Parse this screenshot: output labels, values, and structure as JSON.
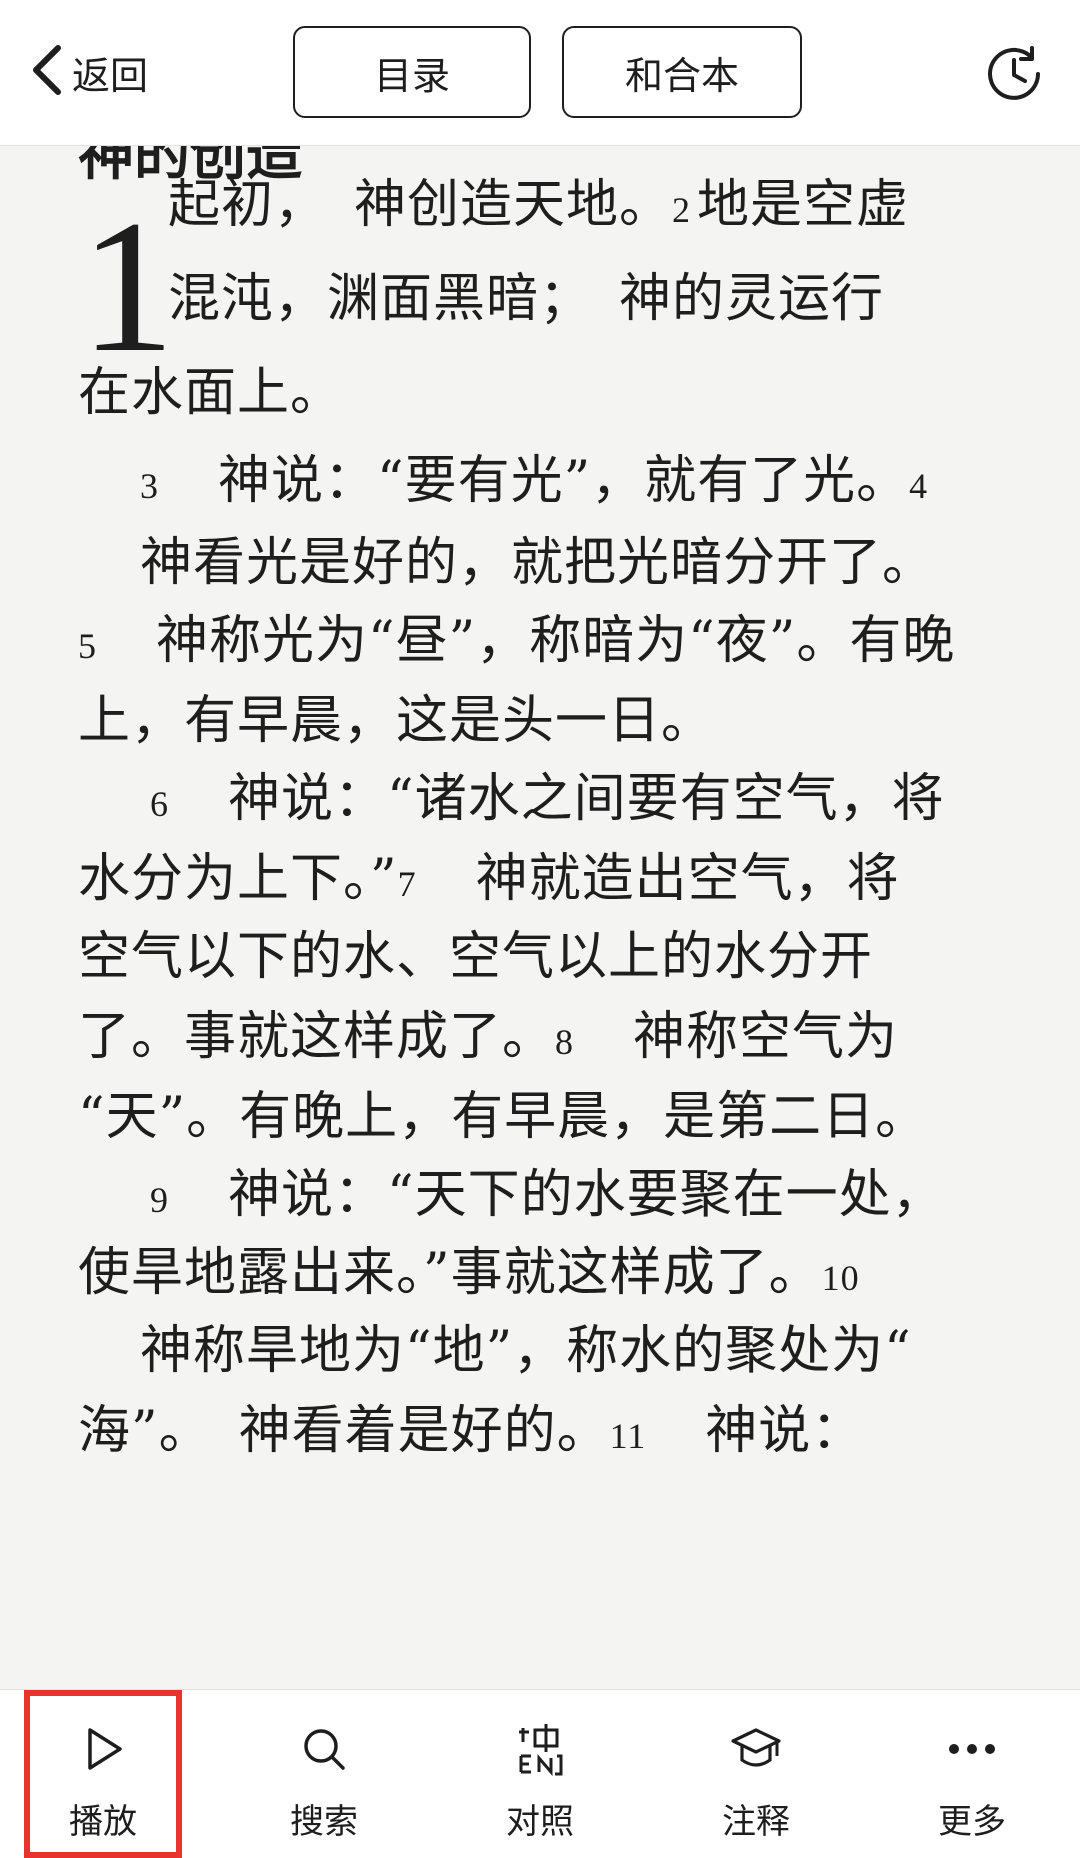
{
  "header": {
    "back_label": "返回",
    "catalog_label": "目录",
    "version_label": "和合本"
  },
  "reader": {
    "chapter_title": "神的创造",
    "chapter_number": "1",
    "lines": [
      {
        "parts": [
          {
            "t": "起初，　神创造天地。"
          },
          {
            "v": "2"
          },
          {
            "t": "地是空虚"
          }
        ]
      },
      {
        "parts": [
          {
            "t": "混沌，渊面黑暗；　神的灵运行"
          }
        ]
      },
      {
        "parts": [
          {
            "t": "在水面上。"
          }
        ]
      },
      {
        "parts": [
          {
            "v": "3"
          },
          {
            "t": "　神说：“要有光”，就有了光。"
          },
          {
            "v": "4"
          }
        ]
      },
      {
        "parts": [
          {
            "t": "神看光是好的，就把光暗分开了。"
          }
        ]
      },
      {
        "parts": [
          {
            "v": "5"
          },
          {
            "t": "　神称光为“昼”，称暗为“夜”。有晚"
          }
        ]
      },
      {
        "parts": [
          {
            "t": "上，有早晨，这是头一日。"
          }
        ]
      },
      {
        "parts": [
          {
            "v": "6"
          },
          {
            "t": "　神说：“诸水之间要有空气，将"
          }
        ]
      },
      {
        "parts": [
          {
            "t": "水分为上下。”"
          },
          {
            "v": "7"
          },
          {
            "t": "　神就造出空气，将"
          }
        ]
      },
      {
        "parts": [
          {
            "t": "空气以下的水、空气以上的水分开"
          }
        ]
      },
      {
        "parts": [
          {
            "t": "了。事就这样成了。"
          },
          {
            "v": "8"
          },
          {
            "t": "　神称空气为"
          }
        ]
      },
      {
        "parts": [
          {
            "t": "“天”。有晚上，有早晨，是第二日。"
          }
        ]
      },
      {
        "parts": [
          {
            "v": "9"
          },
          {
            "t": "　神说：“天下的水要聚在一处，"
          }
        ]
      },
      {
        "parts": [
          {
            "t": "使旱地露出来。”事就这样成了。"
          },
          {
            "v": "10"
          }
        ]
      },
      {
        "parts": [
          {
            "t": "神称旱地为“地”，称水的聚处为“"
          }
        ]
      },
      {
        "parts": [
          {
            "t": "海”。　神看着是好的。"
          },
          {
            "v": "11"
          },
          {
            "t": "　神说："
          }
        ]
      }
    ]
  },
  "bottom_bar": {
    "tabs": [
      {
        "id": "play",
        "label": "播放",
        "icon": "play-icon"
      },
      {
        "id": "search",
        "label": "搜索",
        "icon": "search-icon"
      },
      {
        "id": "compare",
        "label": "对照",
        "icon": "compare-icon"
      },
      {
        "id": "notes",
        "label": "注释",
        "icon": "graduation-cap-icon"
      },
      {
        "id": "more",
        "label": "更多",
        "icon": "more-dots-icon"
      }
    ]
  },
  "colors": {
    "highlight": "#e8322d",
    "background": "#f4f4f2"
  }
}
